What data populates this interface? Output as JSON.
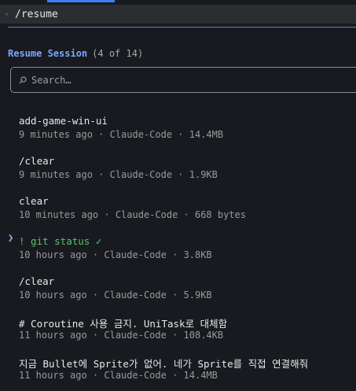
{
  "command": {
    "gutter_glyph": "›",
    "text": "/resume"
  },
  "resume": {
    "label": "Resume Session",
    "count": "(4 of 14)",
    "search_placeholder": "Search…",
    "search_icon": "search-icon"
  },
  "sessions": [
    {
      "title": "add-game-win-ui",
      "meta": "9 minutes ago · Claude-Code · 14.4MB",
      "selected": false
    },
    {
      "title": "/clear",
      "meta": "9 minutes ago · Claude-Code · 1.9KB",
      "selected": false
    },
    {
      "title": "clear",
      "meta": "10 minutes ago · Claude-Code · 668 bytes",
      "selected": false
    },
    {
      "title": "! git status ✓",
      "meta": "10 hours ago · Claude-Code · 3.8KB",
      "selected": true,
      "pointer": "❯"
    },
    {
      "title": "/clear",
      "meta": "10 hours ago · Claude-Code · 5.9KB",
      "selected": false
    },
    {
      "title": "# Coroutine 사용 금지. UniTask로 대체함",
      "meta": "11 hours ago · Claude-Code · 108.4KB",
      "selected": false
    },
    {
      "title": "지금 Bullet에 Sprite가 없어. 네가 Sprite를 직접 연결해줘",
      "meta": "11 hours ago · Claude-Code · 14.4MB",
      "selected": false
    }
  ],
  "colors": {
    "accent": "#7aa7ff",
    "selected": "#58c26a",
    "rule": "#7f86c9"
  }
}
